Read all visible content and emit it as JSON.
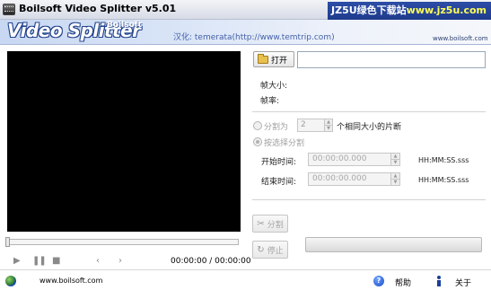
{
  "window": {
    "title": "Boilsoft Video Splitter v5.01",
    "watermark": {
      "part1": "JZ5U绿色下载站",
      "part2": "www.jz5u.com"
    }
  },
  "banner": {
    "logo": "Video Splitter",
    "company": "Boilsoft",
    "translator": "汉化: temerata(http://www.temtrip.com)",
    "site": "www.boilsoft.com"
  },
  "player": {
    "icons": [
      "play-icon",
      "pause-icon",
      "stop-icon",
      "prev-icon",
      "next-icon"
    ],
    "time": "00:00:00 / 00:00:00"
  },
  "file": {
    "open_label": "打开",
    "path": ""
  },
  "info": {
    "frame_size_label": "帧大小:",
    "frame_rate_label": "帧率:"
  },
  "split": {
    "equal_label": "分割为",
    "equal_count": "2",
    "equal_suffix": "个相同大小的片断",
    "select_label": "按选择分割",
    "start_label": "开始时间:",
    "start_value": "00:00:00.000",
    "end_label": "结束时间:",
    "end_value": "00:00:00.000",
    "time_format": "HH:MM:SS.sss"
  },
  "actions": {
    "split_label": "分割",
    "stop_label": "停止",
    "progress": 0
  },
  "footer": {
    "site": "www.boilsoft.com",
    "help_label": "帮助",
    "about_label": "关于"
  }
}
